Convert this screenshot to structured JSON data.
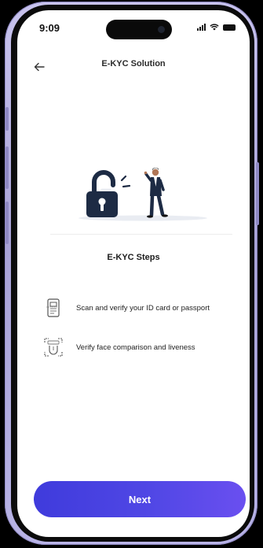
{
  "status_bar": {
    "time": "9:09",
    "icons": [
      "signal-icon",
      "wifi-icon",
      "battery-icon"
    ]
  },
  "header": {
    "back_icon": "arrow-left-icon",
    "title": "E-KYC Solution"
  },
  "illustration": {
    "icons": [
      "padlock-icon",
      "person-icon"
    ]
  },
  "steps": {
    "title": "E-KYC Steps",
    "items": [
      {
        "icon": "id-card-scan-icon",
        "label": "Scan and verify your ID card or passport"
      },
      {
        "icon": "face-scan-icon",
        "label": "Verify face comparison and liveness"
      }
    ]
  },
  "footer": {
    "next_label": "Next"
  },
  "colors": {
    "accent_start": "#3f3bdc",
    "accent_end": "#6a4ff0",
    "lock_body": "#1d2b44",
    "frame": "#b8b3e6"
  }
}
